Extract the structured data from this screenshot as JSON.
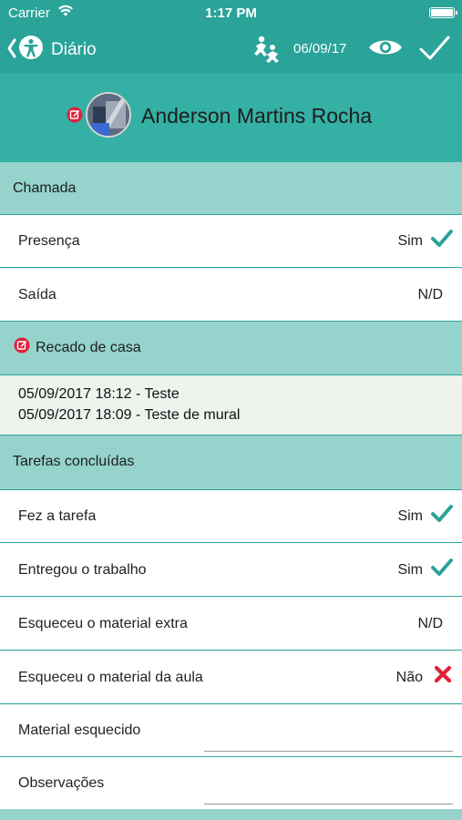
{
  "status_bar": {
    "carrier": "Carrier",
    "time": "1:17 PM"
  },
  "nav": {
    "back_title": "Diário",
    "date": "06/09/17"
  },
  "profile": {
    "name": "Anderson Martins Rocha"
  },
  "chamada": {
    "header": "Chamada",
    "rows": [
      {
        "label": "Presença",
        "value": "Sim",
        "icon": "check-icon"
      },
      {
        "label": "Saída",
        "value": "N/D"
      }
    ]
  },
  "recado": {
    "header": "Recado de casa",
    "messages": [
      "05/09/2017 18:12 - Teste",
      "05/09/2017 18:09 - Teste de mural"
    ]
  },
  "tarefas": {
    "header": "Tarefas concluídas",
    "rows": [
      {
        "label": "Fez a tarefa",
        "value": "Sim",
        "icon": "check-icon"
      },
      {
        "label": "Entregou o trabalho",
        "value": "Sim",
        "icon": "check-icon"
      },
      {
        "label": "Esqueceu o material extra",
        "value": "N/D"
      },
      {
        "label": "Esqueceu o material da aula",
        "value": "Não",
        "icon": "cross-icon"
      },
      {
        "label": "Material esquecido",
        "value": ""
      },
      {
        "label": "Observações",
        "value": ""
      }
    ]
  },
  "colors": {
    "teal": "#2aa399",
    "teal_light": "#95d3cc",
    "check": "#2aa399",
    "cross": "#e0203a",
    "edit_badge": "#e0203a"
  }
}
